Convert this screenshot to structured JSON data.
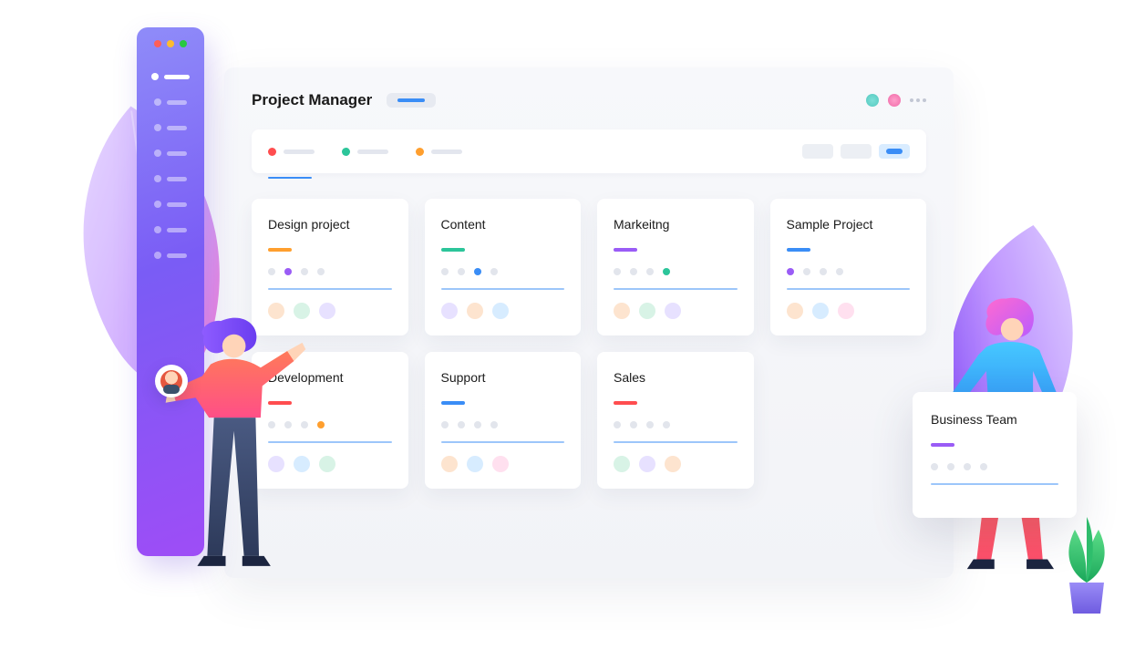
{
  "header": {
    "title": "Project Manager"
  },
  "filter_tabs": [
    {
      "color": "#ff4d4f"
    },
    {
      "color": "#2cc59a"
    },
    {
      "color": "#ff9f2e"
    }
  ],
  "cards": [
    {
      "title": "Design project",
      "accent": "#ff9f2e",
      "highlight_index": 1,
      "highlight_color": "#9a5cf6",
      "chips": [
        "#fde4cf",
        "#d8f3e6",
        "#e7e1ff"
      ]
    },
    {
      "title": "Content",
      "accent": "#2cc59a",
      "highlight_index": 2,
      "highlight_color": "#3a8df6",
      "chips": [
        "#e7e1ff",
        "#fde4cf",
        "#d7ecff"
      ]
    },
    {
      "title": "Markeitng",
      "accent": "#9a5cf6",
      "highlight_index": 3,
      "highlight_color": "#2cc59a",
      "chips": [
        "#fde4cf",
        "#d8f3e6",
        "#e7e1ff"
      ]
    },
    {
      "title": "Sample Project",
      "accent": "#3a8df6",
      "highlight_index": 0,
      "highlight_color": "#9a5cf6",
      "chips": [
        "#fde4cf",
        "#d7ecff",
        "#ffe0ef"
      ]
    },
    {
      "title": "Development",
      "accent": "#ff4d4f",
      "highlight_index": 3,
      "highlight_color": "#ff9f2e",
      "chips": [
        "#e7e1ff",
        "#d7ecff",
        "#d8f3e6"
      ]
    },
    {
      "title": "Support",
      "accent": "#3a8df6",
      "highlight_index": -1,
      "highlight_color": "",
      "chips": [
        "#fde4cf",
        "#d7ecff",
        "#ffe0ef"
      ]
    },
    {
      "title": "Sales",
      "accent": "#ff4d4f",
      "highlight_index": -1,
      "highlight_color": "",
      "chips": [
        "#d8f3e6",
        "#e7e1ff",
        "#fde4cf"
      ]
    }
  ],
  "floating_card": {
    "title": "Business Team",
    "accent": "#9a5cf6"
  }
}
